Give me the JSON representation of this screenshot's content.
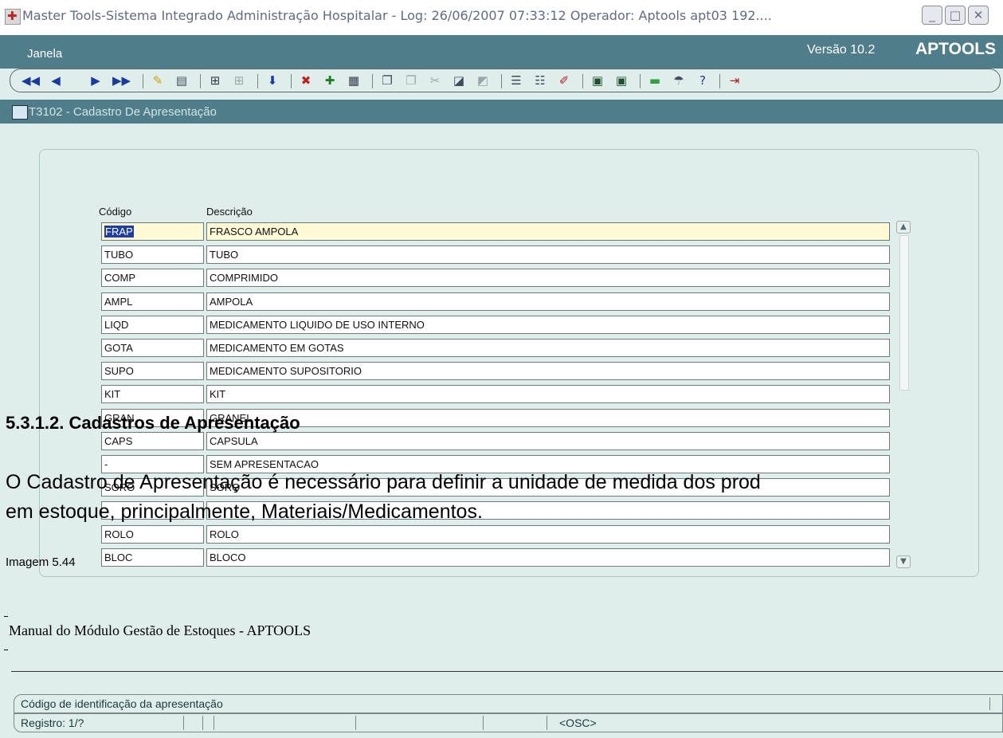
{
  "window": {
    "title": "Master Tools-Sistema Integrado Administração Hospitalar - Log: 26/06/2007 07:33:12 Operador: Aptools apt03 192....",
    "minimize": "_",
    "maximize": "□",
    "close": "✕"
  },
  "menubar": {
    "menu": "Janela",
    "version": "Versão 10.2",
    "brand": "APTOOLS"
  },
  "form": {
    "title": "T3102 - Cadastro De Apresentação",
    "col_code": "Código",
    "col_desc": "Descrição",
    "rows": [
      {
        "code": "FRAP",
        "desc": "FRASCO AMPOLA"
      },
      {
        "code": "TUBO",
        "desc": "TUBO"
      },
      {
        "code": "COMP",
        "desc": "COMPRIMIDO"
      },
      {
        "code": "AMPL",
        "desc": "AMPOLA"
      },
      {
        "code": "LIQD",
        "desc": "MEDICAMENTO LIQUIDO DE USO INTERNO"
      },
      {
        "code": "GOTA",
        "desc": "MEDICAMENTO EM GOTAS"
      },
      {
        "code": "SUPO",
        "desc": "MEDICAMENTO SUPOSITORIO"
      },
      {
        "code": "KIT",
        "desc": "KIT"
      },
      {
        "code": "GRAN",
        "desc": "GRANEL"
      },
      {
        "code": "CAPS",
        "desc": "CAPSULA"
      },
      {
        "code": "-",
        "desc": "SEM APRESENTACAO"
      },
      {
        "code": "SORO",
        "desc": "SORO"
      },
      {
        "code": "",
        "desc": ""
      },
      {
        "code": "ROLO",
        "desc": "ROLO"
      },
      {
        "code": "BLOC",
        "desc": "BLOCO"
      }
    ]
  },
  "manual": {
    "heading": "5.3.1.2. Cadastros de Apresentação",
    "para_line1": "O Cadastro de Apresentação é necessário para definir a unidade de medida dos prod",
    "para_line2": "em estoque, principalmente, Materiais/Medicamentos.",
    "caption": "Imagem 5.44",
    "footer": "Manual do Módulo Gestão de Estoques - APTOOLS"
  },
  "status": {
    "hint": "Código de identificação da apresentação",
    "record": "Registro: 1/?",
    "osc": "<OSC>"
  },
  "colors": {
    "teal_bar": "#4f7d8a",
    "background": "#dfeeeb",
    "selected_cell": "#fffad6",
    "selection": "#1f3fa0"
  },
  "toolbar_icons": [
    "first-record-icon",
    "previous-record-icon",
    "next-record-icon",
    "last-record-icon",
    "edit-pencil-icon",
    "print-icon",
    "query-icon",
    "query-disabled-icon",
    "download-icon",
    "delete-record-icon",
    "insert-record-icon",
    "grid-icon",
    "copy-icon",
    "paste-icon",
    "cut-icon",
    "clear-icon",
    "eraser-icon",
    "list-icon",
    "list2-icon",
    "marker-icon",
    "window-icon",
    "window2-icon",
    "minimize-bar-icon",
    "lookup-icon",
    "help-icon",
    "exit-icon"
  ]
}
